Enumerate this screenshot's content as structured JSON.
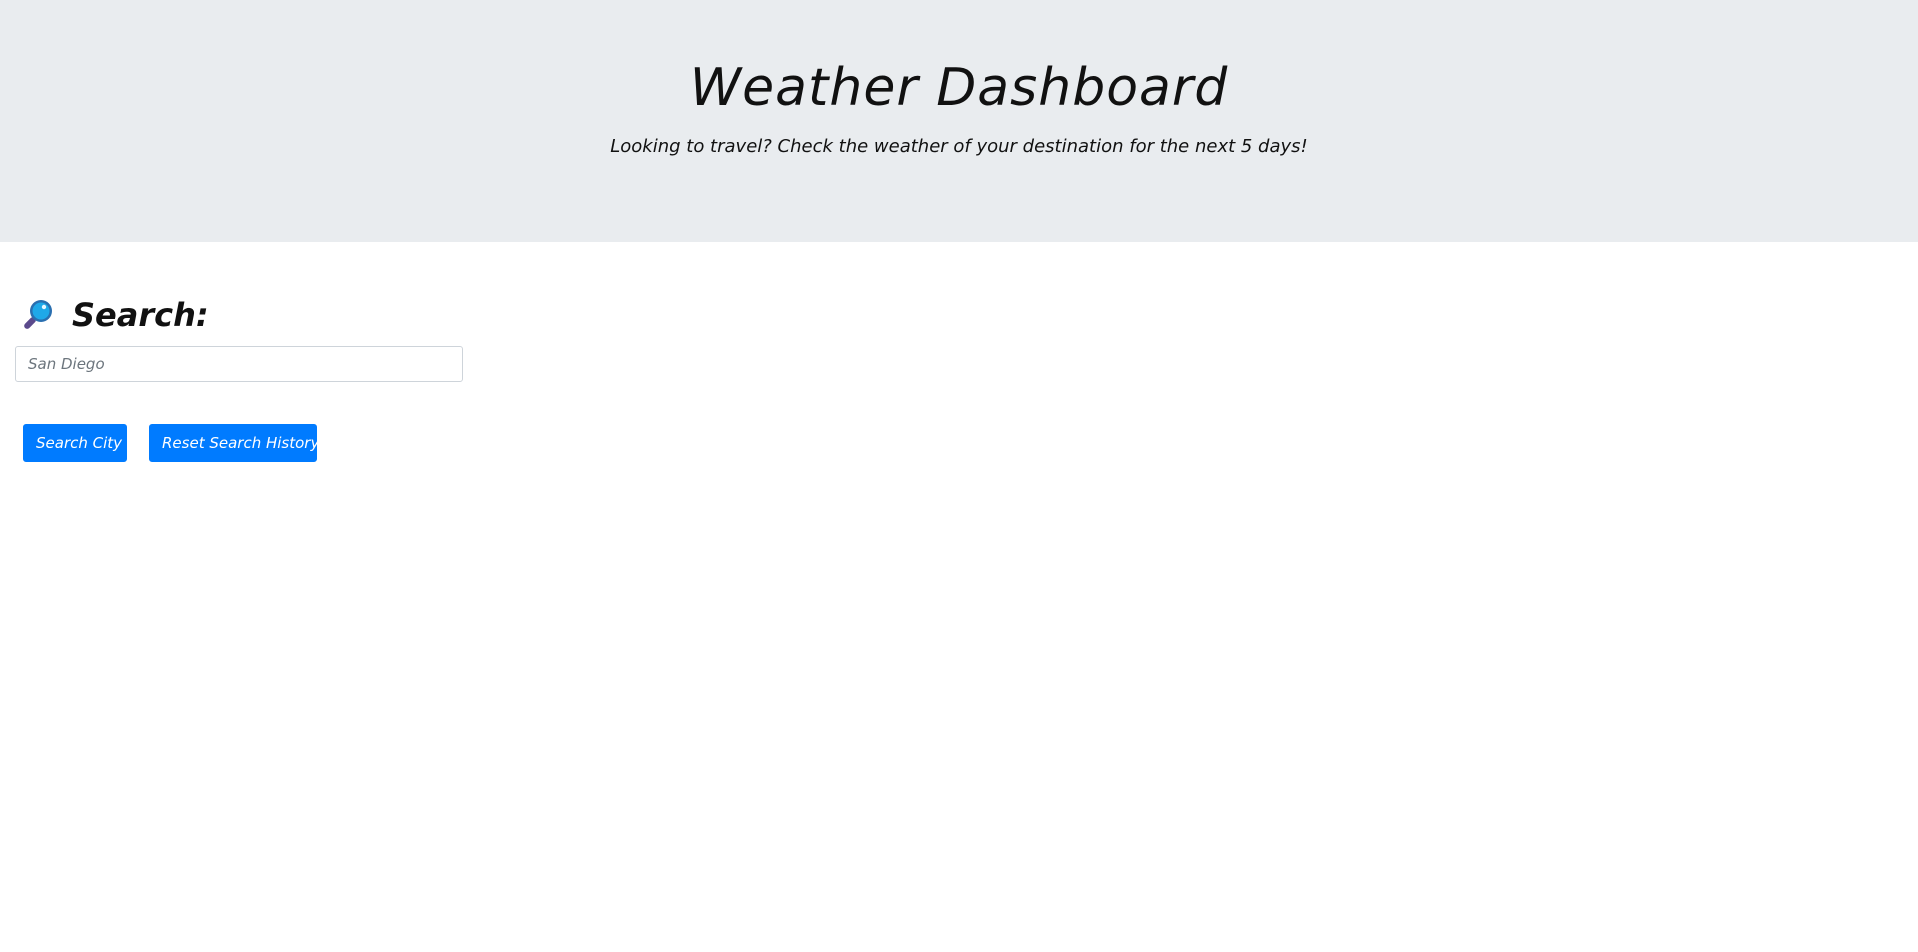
{
  "header": {
    "title": "Weather Dashboard",
    "lead": "Looking to travel? Check the weather of your destination for the next 5 days!"
  },
  "search": {
    "heading": "Search:",
    "icon": "magnifying-glass-icon",
    "input_value": "",
    "input_placeholder": "San Diego",
    "search_button_label": "Search City",
    "reset_button_label": "Reset Search History"
  },
  "colors": {
    "header_bg": "#e9ecef",
    "button_primary": "#007bff",
    "text": "#111111"
  }
}
